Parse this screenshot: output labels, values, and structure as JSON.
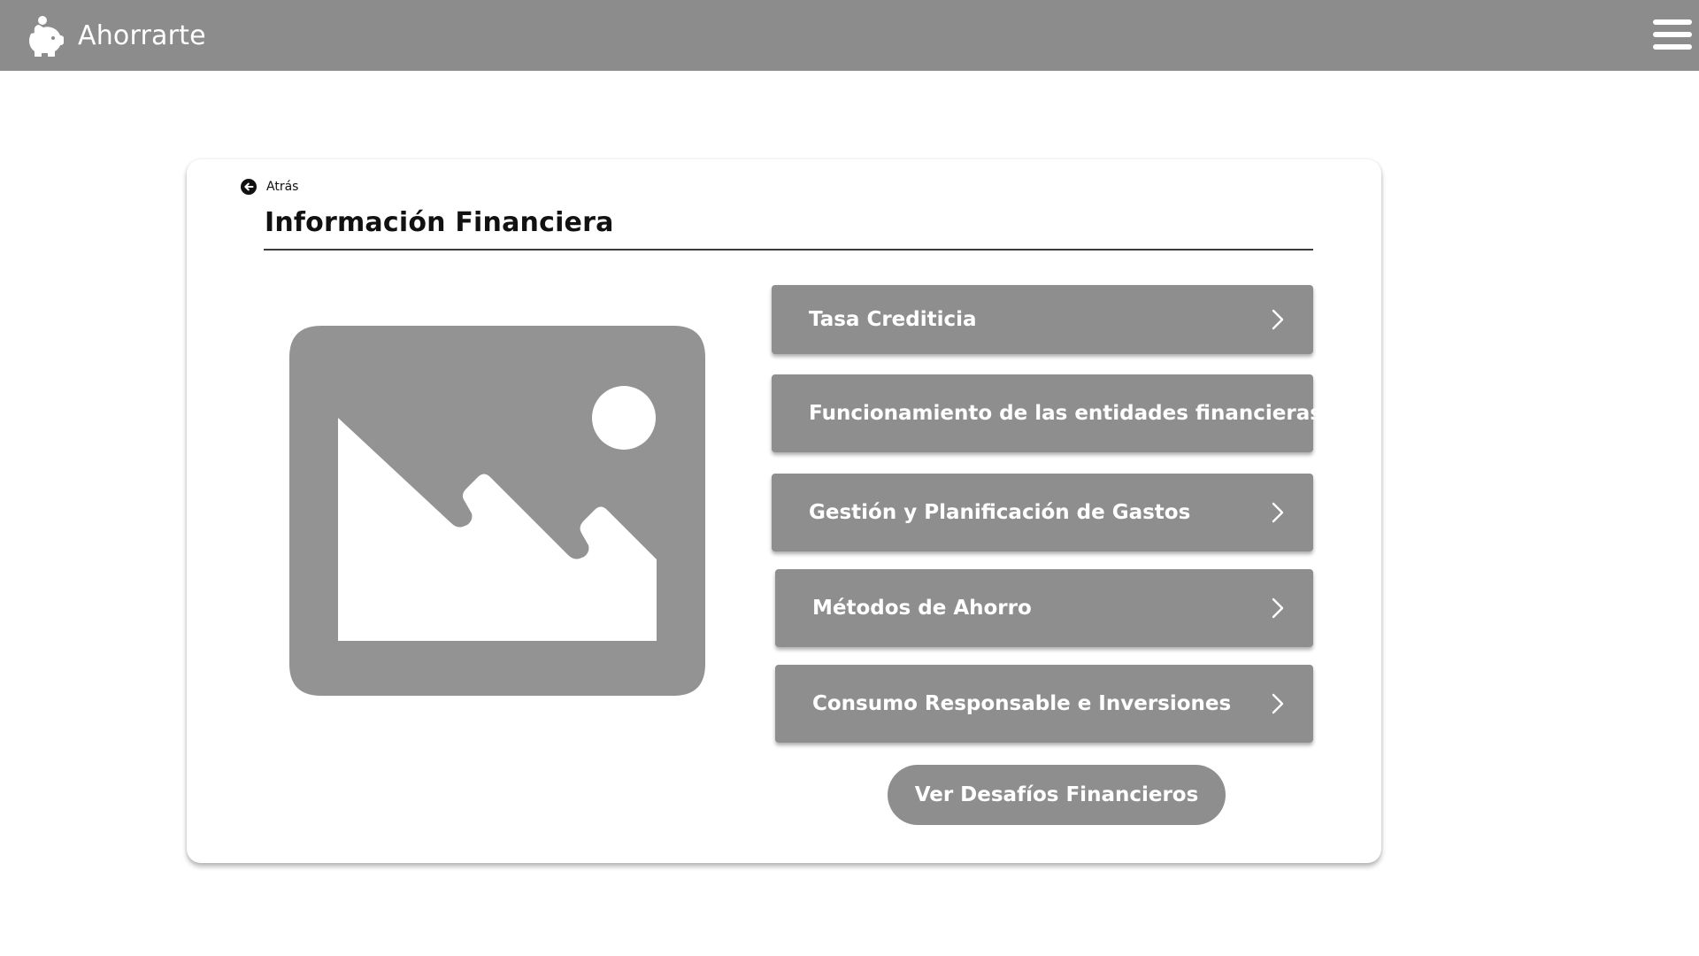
{
  "app": {
    "name": "Ahorrarte",
    "logo_icon": "piggy-bank-icon",
    "menu_icon": "hamburger-menu-icon"
  },
  "nav": {
    "back_label": "Atrás",
    "back_icon": "arrow-left-circle-icon"
  },
  "page": {
    "title": "Información Financiera",
    "image_icon": "image-placeholder-icon"
  },
  "topics": [
    {
      "label": "Tasa Crediticia",
      "icon": "chevron-right-icon"
    },
    {
      "label": "Funcionamiento de las entidades financieras",
      "icon": "chevron-right-icon"
    },
    {
      "label": "Gestión y Planificación de Gastos",
      "icon": "chevron-right-icon"
    },
    {
      "label": "Métodos de Ahorro",
      "icon": "chevron-right-icon"
    },
    {
      "label": "Consumo Responsable e Inversiones",
      "icon": "chevron-right-icon"
    }
  ],
  "cta": {
    "label": "Ver Desafíos Financieros"
  },
  "colors": {
    "header_bg": "#8c8c8c",
    "button_bg": "#8e8e8e",
    "text_light": "#ffffff",
    "text_dark": "#111111"
  }
}
